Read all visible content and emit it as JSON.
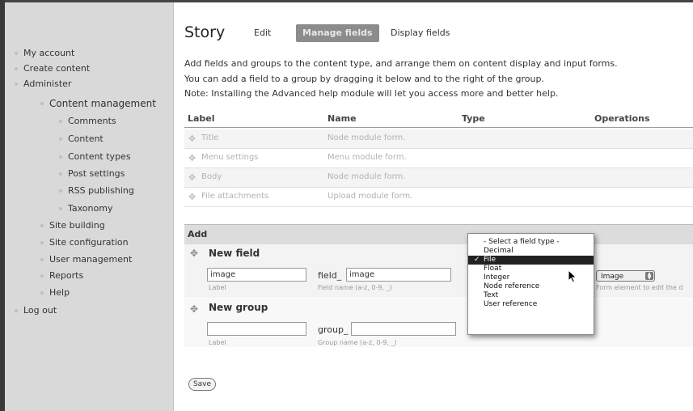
{
  "sidebar": {
    "items": [
      {
        "label": "My account"
      },
      {
        "label": "Create content"
      },
      {
        "label": "Administer"
      },
      {
        "label": "Content management"
      },
      {
        "label": "Comments"
      },
      {
        "label": "Content"
      },
      {
        "label": "Content types"
      },
      {
        "label": "Post settings"
      },
      {
        "label": "RSS publishing"
      },
      {
        "label": "Taxonomy"
      },
      {
        "label": "Site building"
      },
      {
        "label": "Site configuration"
      },
      {
        "label": "User management"
      },
      {
        "label": "Reports"
      },
      {
        "label": "Help"
      },
      {
        "label": "Log out"
      }
    ]
  },
  "page": {
    "title": "Story",
    "tabs": [
      {
        "label": "Edit",
        "active": false
      },
      {
        "label": "Manage fields",
        "active": true
      },
      {
        "label": "Display fields",
        "active": false
      }
    ],
    "help": [
      "Add fields and groups to the content type, and arrange them on content display and input forms.",
      "You can add a field to a group by dragging it below and to the right of the group.",
      "Note: Installing the Advanced help module will let you access more and better help."
    ]
  },
  "table": {
    "headers": [
      "Label",
      "Name",
      "Type",
      "Operations"
    ],
    "rows": [
      {
        "label": "Title",
        "name": "Node module form."
      },
      {
        "label": "Menu settings",
        "name": "Menu module form."
      },
      {
        "label": "Body",
        "name": "Node module form."
      },
      {
        "label": "File attachments",
        "name": "Upload module form."
      }
    ]
  },
  "add": {
    "title": "Add",
    "new_field": {
      "title": "New field",
      "label_value": "image",
      "label_caption": "Label",
      "name_prefix": "field_",
      "name_value": "image",
      "name_caption": "Field name (a-z, 0-9, _)",
      "widget_value": "Image",
      "widget_caption": "Form element to edit the d"
    },
    "new_group": {
      "title": "New group",
      "label_value": "",
      "label_caption": "Label",
      "name_prefix": "group_",
      "name_value": "",
      "name_caption": "Group name (a-z, 0-9, _)"
    }
  },
  "field_type_dropdown": {
    "selected": "File",
    "options": [
      "- Select a field type -",
      "Decimal",
      "File",
      "Float",
      "Integer",
      "Node reference",
      "Text",
      "User reference"
    ]
  },
  "save_label": "Save",
  "icons": {
    "drag_handle": "drag-cross-icon",
    "checkmark": "checkmark-icon",
    "cursor": "mouse-pointer-icon",
    "bullet": "bullet-icon"
  }
}
